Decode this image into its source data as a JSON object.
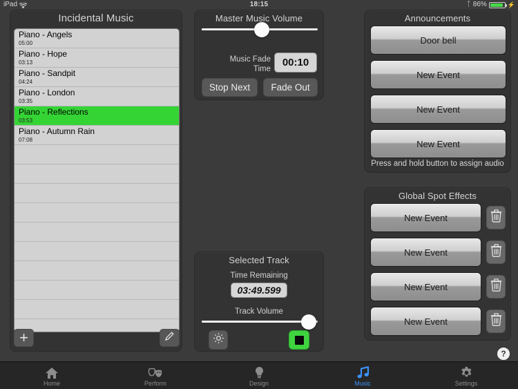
{
  "statusbar": {
    "device": "iPad",
    "wifi_icon": "wifi-icon",
    "time": "18:15",
    "bluetooth_icon": "bluetooth-icon",
    "battery_percent": "86%",
    "battery_icon": "battery-icon",
    "charging_icon": "plug-icon"
  },
  "left_panel": {
    "title": "Incidental Music",
    "tracks": [
      {
        "name": "Piano - Angels",
        "time": "05:00",
        "selected": false
      },
      {
        "name": "Piano - Hope",
        "time": "03:13",
        "selected": false
      },
      {
        "name": "Piano - Sandpit",
        "time": "04:24",
        "selected": false
      },
      {
        "name": "Piano - London",
        "time": "03:35",
        "selected": false
      },
      {
        "name": "Piano - Reflections",
        "time": "03:53",
        "selected": true
      },
      {
        "name": "Piano - Autumn Rain",
        "time": "07:08",
        "selected": false
      }
    ],
    "empty_row_count": 9,
    "selected_color": "#35d435",
    "add_button_icon": "plus-icon",
    "edit_button_icon": "pencil-icon"
  },
  "master_panel": {
    "title": "Master Music Volume",
    "volume_percent": 52,
    "fade_label_line1": "Music Fade",
    "fade_label_line2": "Time",
    "fade_time_value": "00:10",
    "stop_next_label": "Stop Next",
    "fade_out_label": "Fade Out"
  },
  "selected_track_panel": {
    "title": "Selected Track",
    "time_remaining_label": "Time Remaining",
    "time_remaining_value": "03:49.599",
    "track_volume_label": "Track Volume",
    "track_volume_percent": 92,
    "settings_icon": "gear-icon",
    "stop_icon": "stop-square-icon",
    "stop_color": "#3fd43f"
  },
  "announcements_panel": {
    "title": "Announcements",
    "buttons": [
      "Door bell",
      "New Event",
      "New Event",
      "New Event"
    ],
    "hint": "Press and hold button to assign audio"
  },
  "spot_effects_panel": {
    "title": "Global Spot Effects",
    "rows": [
      {
        "label": "New Event",
        "delete_icon": "trash-icon"
      },
      {
        "label": "New Event",
        "delete_icon": "trash-icon"
      },
      {
        "label": "New Event",
        "delete_icon": "trash-icon"
      },
      {
        "label": "New Event",
        "delete_icon": "trash-icon"
      }
    ]
  },
  "help": {
    "label": "?"
  },
  "tabbar": {
    "active_color": "#3b93f7",
    "tabs": [
      {
        "label": "Home",
        "icon": "home-icon",
        "active": false
      },
      {
        "label": "Perform",
        "icon": "masks-icon",
        "active": false
      },
      {
        "label": "Design",
        "icon": "bulb-icon",
        "active": false
      },
      {
        "label": "Music",
        "icon": "music-note-icon",
        "active": true
      },
      {
        "label": "Settings",
        "icon": "gear-icon",
        "active": false
      }
    ]
  }
}
